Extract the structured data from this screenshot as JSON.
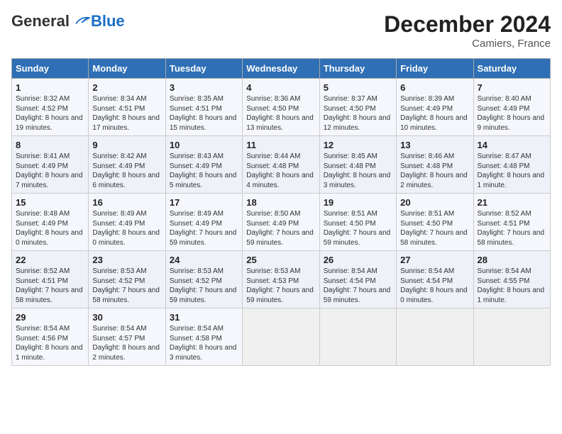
{
  "header": {
    "logo_general": "General",
    "logo_blue": "Blue",
    "month_title": "December 2024",
    "location": "Camiers, France"
  },
  "days_of_week": [
    "Sunday",
    "Monday",
    "Tuesday",
    "Wednesday",
    "Thursday",
    "Friday",
    "Saturday"
  ],
  "weeks": [
    [
      {
        "day": "1",
        "sunrise": "Sunrise: 8:32 AM",
        "sunset": "Sunset: 4:52 PM",
        "daylight": "Daylight: 8 hours and 19 minutes."
      },
      {
        "day": "2",
        "sunrise": "Sunrise: 8:34 AM",
        "sunset": "Sunset: 4:51 PM",
        "daylight": "Daylight: 8 hours and 17 minutes."
      },
      {
        "day": "3",
        "sunrise": "Sunrise: 8:35 AM",
        "sunset": "Sunset: 4:51 PM",
        "daylight": "Daylight: 8 hours and 15 minutes."
      },
      {
        "day": "4",
        "sunrise": "Sunrise: 8:36 AM",
        "sunset": "Sunset: 4:50 PM",
        "daylight": "Daylight: 8 hours and 13 minutes."
      },
      {
        "day": "5",
        "sunrise": "Sunrise: 8:37 AM",
        "sunset": "Sunset: 4:50 PM",
        "daylight": "Daylight: 8 hours and 12 minutes."
      },
      {
        "day": "6",
        "sunrise": "Sunrise: 8:39 AM",
        "sunset": "Sunset: 4:49 PM",
        "daylight": "Daylight: 8 hours and 10 minutes."
      },
      {
        "day": "7",
        "sunrise": "Sunrise: 8:40 AM",
        "sunset": "Sunset: 4:49 PM",
        "daylight": "Daylight: 8 hours and 9 minutes."
      }
    ],
    [
      {
        "day": "8",
        "sunrise": "Sunrise: 8:41 AM",
        "sunset": "Sunset: 4:49 PM",
        "daylight": "Daylight: 8 hours and 7 minutes."
      },
      {
        "day": "9",
        "sunrise": "Sunrise: 8:42 AM",
        "sunset": "Sunset: 4:49 PM",
        "daylight": "Daylight: 8 hours and 6 minutes."
      },
      {
        "day": "10",
        "sunrise": "Sunrise: 8:43 AM",
        "sunset": "Sunset: 4:49 PM",
        "daylight": "Daylight: 8 hours and 5 minutes."
      },
      {
        "day": "11",
        "sunrise": "Sunrise: 8:44 AM",
        "sunset": "Sunset: 4:48 PM",
        "daylight": "Daylight: 8 hours and 4 minutes."
      },
      {
        "day": "12",
        "sunrise": "Sunrise: 8:45 AM",
        "sunset": "Sunset: 4:48 PM",
        "daylight": "Daylight: 8 hours and 3 minutes."
      },
      {
        "day": "13",
        "sunrise": "Sunrise: 8:46 AM",
        "sunset": "Sunset: 4:48 PM",
        "daylight": "Daylight: 8 hours and 2 minutes."
      },
      {
        "day": "14",
        "sunrise": "Sunrise: 8:47 AM",
        "sunset": "Sunset: 4:48 PM",
        "daylight": "Daylight: 8 hours and 1 minute."
      }
    ],
    [
      {
        "day": "15",
        "sunrise": "Sunrise: 8:48 AM",
        "sunset": "Sunset: 4:49 PM",
        "daylight": "Daylight: 8 hours and 0 minutes."
      },
      {
        "day": "16",
        "sunrise": "Sunrise: 8:49 AM",
        "sunset": "Sunset: 4:49 PM",
        "daylight": "Daylight: 8 hours and 0 minutes."
      },
      {
        "day": "17",
        "sunrise": "Sunrise: 8:49 AM",
        "sunset": "Sunset: 4:49 PM",
        "daylight": "Daylight: 7 hours and 59 minutes."
      },
      {
        "day": "18",
        "sunrise": "Sunrise: 8:50 AM",
        "sunset": "Sunset: 4:49 PM",
        "daylight": "Daylight: 7 hours and 59 minutes."
      },
      {
        "day": "19",
        "sunrise": "Sunrise: 8:51 AM",
        "sunset": "Sunset: 4:50 PM",
        "daylight": "Daylight: 7 hours and 59 minutes."
      },
      {
        "day": "20",
        "sunrise": "Sunrise: 8:51 AM",
        "sunset": "Sunset: 4:50 PM",
        "daylight": "Daylight: 7 hours and 58 minutes."
      },
      {
        "day": "21",
        "sunrise": "Sunrise: 8:52 AM",
        "sunset": "Sunset: 4:51 PM",
        "daylight": "Daylight: 7 hours and 58 minutes."
      }
    ],
    [
      {
        "day": "22",
        "sunrise": "Sunrise: 8:52 AM",
        "sunset": "Sunset: 4:51 PM",
        "daylight": "Daylight: 7 hours and 58 minutes."
      },
      {
        "day": "23",
        "sunrise": "Sunrise: 8:53 AM",
        "sunset": "Sunset: 4:52 PM",
        "daylight": "Daylight: 7 hours and 58 minutes."
      },
      {
        "day": "24",
        "sunrise": "Sunrise: 8:53 AM",
        "sunset": "Sunset: 4:52 PM",
        "daylight": "Daylight: 7 hours and 59 minutes."
      },
      {
        "day": "25",
        "sunrise": "Sunrise: 8:53 AM",
        "sunset": "Sunset: 4:53 PM",
        "daylight": "Daylight: 7 hours and 59 minutes."
      },
      {
        "day": "26",
        "sunrise": "Sunrise: 8:54 AM",
        "sunset": "Sunset: 4:54 PM",
        "daylight": "Daylight: 7 hours and 59 minutes."
      },
      {
        "day": "27",
        "sunrise": "Sunrise: 8:54 AM",
        "sunset": "Sunset: 4:54 PM",
        "daylight": "Daylight: 8 hours and 0 minutes."
      },
      {
        "day": "28",
        "sunrise": "Sunrise: 8:54 AM",
        "sunset": "Sunset: 4:55 PM",
        "daylight": "Daylight: 8 hours and 1 minute."
      }
    ],
    [
      {
        "day": "29",
        "sunrise": "Sunrise: 8:54 AM",
        "sunset": "Sunset: 4:56 PM",
        "daylight": "Daylight: 8 hours and 1 minute."
      },
      {
        "day": "30",
        "sunrise": "Sunrise: 8:54 AM",
        "sunset": "Sunset: 4:57 PM",
        "daylight": "Daylight: 8 hours and 2 minutes."
      },
      {
        "day": "31",
        "sunrise": "Sunrise: 8:54 AM",
        "sunset": "Sunset: 4:58 PM",
        "daylight": "Daylight: 8 hours and 3 minutes."
      },
      null,
      null,
      null,
      null
    ]
  ]
}
